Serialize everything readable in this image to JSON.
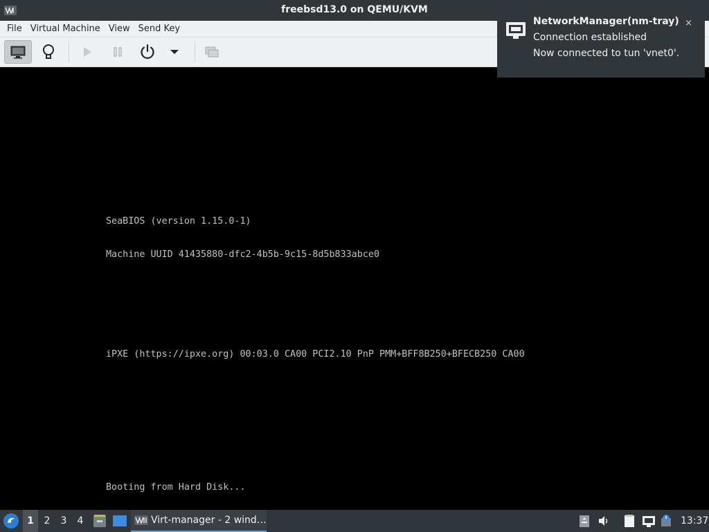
{
  "window": {
    "title": "freebsd13.0 on QEMU/KVM",
    "app_icon": "virt-manager-icon"
  },
  "menubar": {
    "items": [
      "File",
      "Virtual Machine",
      "View",
      "Send Key"
    ]
  },
  "toolbar": {
    "buttons": [
      {
        "name": "show-console",
        "icon": "monitor-icon",
        "active": true
      },
      {
        "name": "show-details",
        "icon": "lightbulb-icon",
        "active": false
      },
      {
        "name": "run",
        "icon": "play-icon",
        "active": false
      },
      {
        "name": "pause",
        "icon": "pause-icon",
        "active": false
      },
      {
        "name": "shutdown",
        "icon": "power-icon",
        "active": false
      },
      {
        "name": "shutdown-menu",
        "icon": "dropdown-arrow-icon",
        "active": false
      },
      {
        "name": "fullscreen",
        "icon": "fullscreen-icon",
        "active": false
      }
    ]
  },
  "console": {
    "lines": [
      "SeaBIOS (version 1.15.0-1)",
      "Machine UUID 41435880-dfc2-4b5b-9c15-8d5b833abce0",
      "",
      "",
      "iPXE (https://ipxe.org) 00:03.0 CA00 PCI2.10 PnP PMM+BFF8B250+BFECB250 CA00",
      "",
      "",
      "",
      "Booting from Hard Disk...",
      "/"
    ]
  },
  "notification": {
    "title": "NetworkManager(nm-tray)",
    "line1": "Connection established",
    "line2": "Now connected to tun 'vnet0'.",
    "close": "×",
    "icon": "network-wired-icon"
  },
  "taskbar": {
    "desktops": [
      "1",
      "2",
      "3",
      "4"
    ],
    "active_desktop": "1",
    "task_label": "Virt-manager - 2 wind…",
    "clock": "13:37",
    "tray_icons": [
      "clipboard-icon",
      "volume-icon",
      "notes-icon",
      "network-icon",
      "update-icon"
    ]
  },
  "colors": {
    "panel": "#31363b",
    "menu_bg": "#eff0f1",
    "accent": "#3daee9",
    "console_text": "#c0c0c0"
  }
}
